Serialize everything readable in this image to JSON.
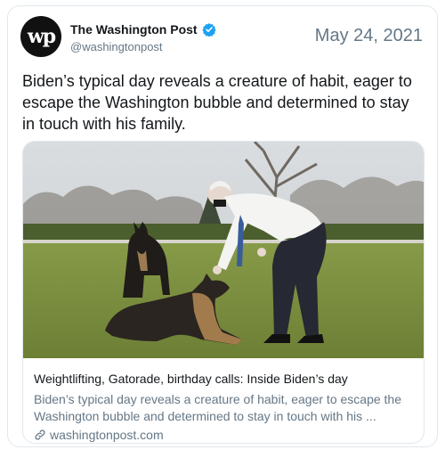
{
  "account": {
    "avatar_text": "wp",
    "name": "The Washington Post",
    "handle": "@washingtonpost"
  },
  "tweet": {
    "date": "May 24, 2021",
    "text": "Biden’s typical day reveals a creature of habit, eager to escape the Washington bubble and determined to stay in touch with his family."
  },
  "card": {
    "title": "Weightlifting, Gatorade, birthday calls: Inside Biden’s day",
    "description": "Biden’s typical day reveals a creature of habit, eager to escape the Washington bubble and determined to stay in touch with his ...",
    "domain": "washingtonpost.com"
  },
  "icons": {
    "verified": "verified-badge-icon",
    "link": "link-icon"
  },
  "colors": {
    "verified": "#1da1f2",
    "secondary_text": "#657786",
    "primary_text": "#14171a",
    "border": "#e1e8ed"
  }
}
